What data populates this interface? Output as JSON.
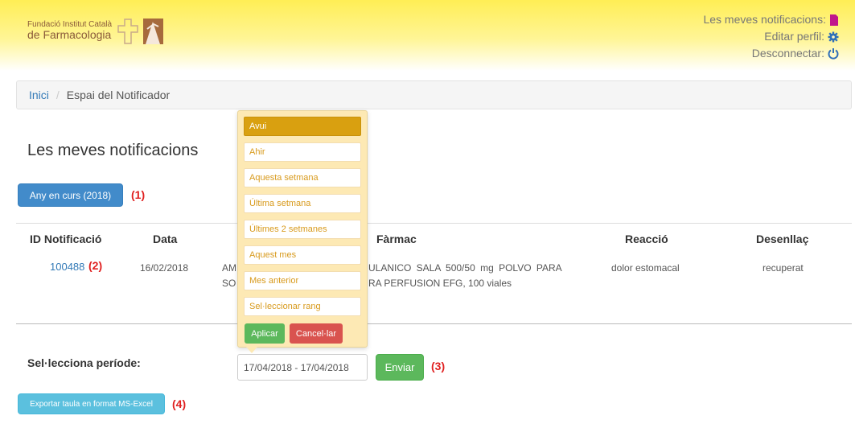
{
  "header": {
    "logo_line1": "Fundació Institut Català",
    "logo_line2_prefix": "de ",
    "logo_line2_name": "Farmacologia",
    "menu": {
      "notifications": "Les meves notificacions:",
      "edit_profile": "Editar perfil:",
      "logout": "Desconnectar:"
    },
    "icons": [
      "file-icon",
      "gear-icon",
      "power-icon"
    ]
  },
  "breadcrumb": {
    "home": "Inici",
    "separator": "/",
    "current": "Espai del Notificador"
  },
  "page_title": "Les meves notificacions",
  "year_button": "Any en curs (2018)",
  "markers": {
    "m1": "(1)",
    "m2": "(2)",
    "m3": "(3)",
    "m4": "(4)"
  },
  "table": {
    "headers": [
      "ID Notificació",
      "Data",
      "Fàrmac",
      "Reacció",
      "Desenllaç"
    ],
    "row": {
      "id": "100488",
      "date": "16/02/2018",
      "drug_line1_left": "AM",
      "drug_line1_right": "ULANICO SALA 500/50 mg POLVO PARA",
      "drug_line2_left": "SO",
      "drug_line2_right": "RA PERFUSION EFG, 100 viales",
      "reaction": "dolor estomacal",
      "outcome": "recuperat"
    }
  },
  "period": {
    "label": "Sel·lecciona període:",
    "value": "17/04/2018 - 17/04/2018",
    "send": "Enviar"
  },
  "daterange": {
    "ranges": [
      "Avui",
      "Ahir",
      "Aquesta setmana",
      "Última setmana",
      "Últimes 2 setmanes",
      "Aquest mes",
      "Mes anterior",
      "Sel·leccionar rang"
    ],
    "selected_index": 0,
    "apply": "Aplicar",
    "cancel": "Cancel·lar"
  },
  "export_button": "Exportar taula en format MS-Excel",
  "colors": {
    "accent_blue": "#428bca",
    "success": "#5cb85c",
    "danger": "#d9534f",
    "info": "#5bc0de",
    "range_active": "#d9a010"
  }
}
